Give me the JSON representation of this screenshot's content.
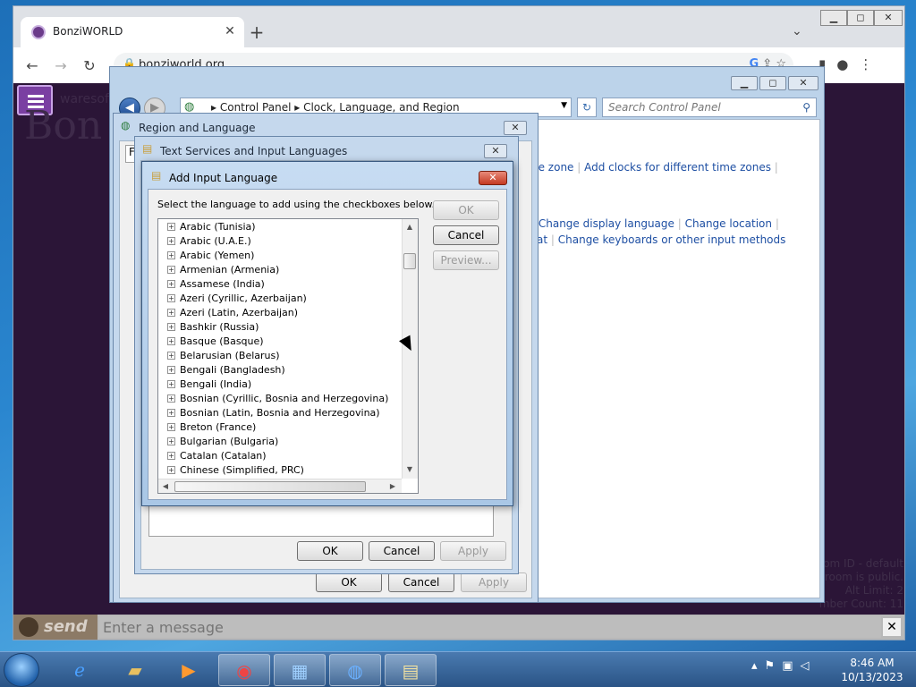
{
  "browser": {
    "tab_title": "BonziWORLD",
    "url": "bonziworld.org"
  },
  "page": {
    "brand_partial": "Bon",
    "brand_sub": "waresof",
    "room_info": [
      "om ID - default",
      "room is public.",
      "Alt Limit: 2",
      "mber Count: 11"
    ],
    "send_label": "send",
    "message_placeholder": "Enter a message"
  },
  "control_panel": {
    "breadcrumb": [
      "Control Panel",
      "Clock, Language, and Region"
    ],
    "search_placeholder": "Search Control Panel",
    "links_row1": [
      "ne zone",
      "Add clocks for different time zones"
    ],
    "links_row2": [
      "Change display language",
      "Change location"
    ],
    "links_row3": [
      "at",
      "Change keyboards or other input methods"
    ]
  },
  "region_language": {
    "title": "Region and Language",
    "tab_char": "F",
    "ok": "OK",
    "cancel": "Cancel",
    "apply": "Apply"
  },
  "text_services": {
    "title": "Text Services and Input Languages",
    "ok": "OK",
    "cancel": "Cancel",
    "apply": "Apply"
  },
  "add_input_language": {
    "title": "Add Input Language",
    "instruction": "Select the language to add using the checkboxes below.",
    "ok": "OK",
    "cancel": "Cancel",
    "preview": "Preview...",
    "languages": [
      "Arabic (Tunisia)",
      "Arabic (U.A.E.)",
      "Arabic (Yemen)",
      "Armenian (Armenia)",
      "Assamese (India)",
      "Azeri (Cyrillic, Azerbaijan)",
      "Azeri (Latin, Azerbaijan)",
      "Bashkir (Russia)",
      "Basque (Basque)",
      "Belarusian (Belarus)",
      "Bengali (Bangladesh)",
      "Bengali (India)",
      "Bosnian (Cyrillic, Bosnia and Herzegovina)",
      "Bosnian (Latin, Bosnia and Herzegovina)",
      "Breton (France)",
      "Bulgarian (Bulgaria)",
      "Catalan (Catalan)",
      "Chinese (Simplified, PRC)"
    ]
  },
  "taskbar": {
    "time": "8:46 AM",
    "date": "10/13/2023"
  },
  "icons": [
    "bonzi-icon",
    "close-icon",
    "plus-icon",
    "back-arrow-icon",
    "forward-arrow-icon",
    "reload-icon",
    "lock-icon",
    "google-icon",
    "share-icon",
    "star-icon",
    "sidepanel-icon",
    "profile-icon",
    "kebab-menu-icon",
    "hamburger-icon",
    "globe-icon",
    "refresh-icon",
    "search-icon",
    "keyboard-icon",
    "windows-start-icon",
    "ie-icon",
    "folder-icon",
    "media-player-icon",
    "chrome-icon",
    "control-panel-icon",
    "network-icon",
    "flag-icon",
    "volume-mute-icon"
  ]
}
